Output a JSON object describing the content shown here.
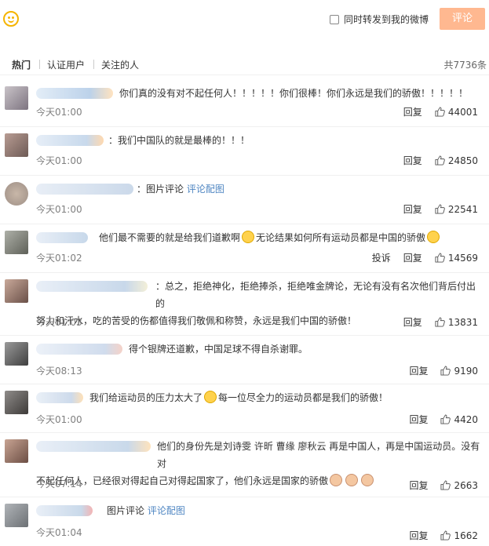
{
  "topbar": {
    "repost_label": "同时转发到我的微博",
    "submit_label": "评论"
  },
  "tabs": [
    {
      "label": "热门"
    },
    {
      "label": "认证用户"
    },
    {
      "label": "关注的人"
    }
  ],
  "total_label": "共7736条",
  "comments": [
    {
      "text": "你们真的没有对不起任何人！！！！！你们很棒！你们永远是我们的骄傲！！！！！",
      "time": "今天01:00",
      "reply": "回复",
      "likes": "44001"
    },
    {
      "text": "：我们中国队的就是最棒的！！！",
      "time": "今天01:00",
      "reply": "回复",
      "likes": "24850"
    },
    {
      "text_prefix": "：图片评论",
      "link": "评论配图",
      "time": "今天01:00",
      "reply": "回复",
      "likes": "22541"
    },
    {
      "text_a": "他们最不需要的就是给我们道歉啊",
      "text_b": "无论结果如何所有运动员都是中国的骄傲",
      "time": "今天01:02",
      "report": "投诉",
      "reply": "回复",
      "likes": "14569"
    },
    {
      "text_line1": "：总之，拒绝神化，拒绝捧杀，拒绝唯金牌论，无论有没有名次他们背后付出的",
      "text_line2": "努力和汗水，吃的苦受的伤都值得我们敬佩和称赞，永远是我们中国的骄傲！",
      "time": "今天01:03",
      "reply": "回复",
      "likes": "13831"
    },
    {
      "text": "得个银牌还道歉，中国足球不得自杀谢罪。",
      "time": "今天08:13",
      "reply": "回复",
      "likes": "9190"
    },
    {
      "text_a": "我们给运动员的压力太大了",
      "text_b": "每一位尽全力的运动员都是我们的骄傲！",
      "time": "今天01:00",
      "reply": "回复",
      "likes": "4420"
    },
    {
      "text_line1": "他们的身份先是刘诗雯 许昕 曹缘 廖秋云 再是中国人，再是中国运动员。没有对",
      "text_line2": "不起任何人，已经很对得起自己对得起国家了，他们永远是国家的骄傲",
      "time": "今天07:14",
      "reply": "回复",
      "likes": "2663"
    },
    {
      "text_prefix": "图片评论",
      "link": "评论配图",
      "time": "今天01:04",
      "reply": "回复",
      "likes": "1662"
    }
  ],
  "colors": {
    "accent": "#ffb890",
    "link": "#4f86c2",
    "muted": "#808080"
  }
}
